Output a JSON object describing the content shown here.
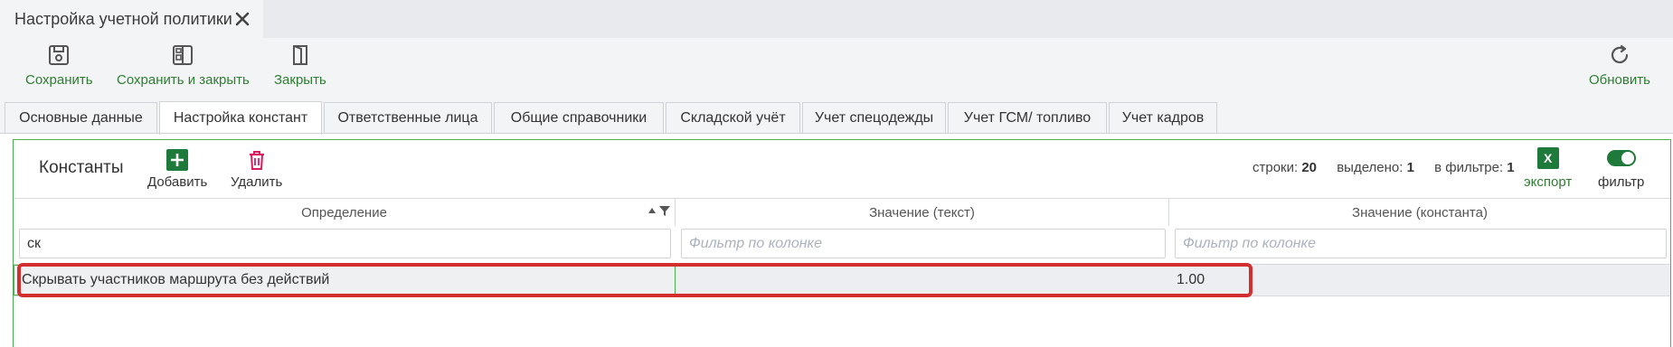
{
  "document_tab": {
    "title": "Настройка учетной политики"
  },
  "toolbar": {
    "save": "Сохранить",
    "save_close": "Сохранить и закрыть",
    "close": "Закрыть",
    "refresh": "Обновить"
  },
  "tabs": [
    "Основные данные",
    "Настройка констант",
    "Ответственные лица",
    "Общие справочники",
    "Складской учёт",
    "Учет спецодежды",
    "Учет ГСМ/ топливо",
    "Учет кадров"
  ],
  "active_tab": "Настройка констант",
  "panel": {
    "title": "Константы",
    "add": "Добавить",
    "delete": "Удалить",
    "stats": {
      "rows_label": "строки:",
      "rows": "20",
      "selected_label": "выделено:",
      "selected": "1",
      "filtered_label": "в фильтре:",
      "filtered": "1"
    },
    "export": "экспорт",
    "filter": "фильтр",
    "filter_enabled": true
  },
  "grid": {
    "columns": [
      "Определение",
      "Значение (текст)",
      "Значение (константа)"
    ],
    "filters": [
      {
        "value": "ск",
        "placeholder": ""
      },
      {
        "value": "",
        "placeholder": "Фильтр по колонке"
      },
      {
        "value": "",
        "placeholder": "Фильтр по колонке"
      }
    ],
    "rows": [
      [
        "Скрывать участников маршрута без действий",
        "",
        "1.00"
      ]
    ]
  },
  "colors": {
    "accent": "#2e7d32",
    "highlight": "#d32f2f",
    "delete": "#d81b60"
  }
}
